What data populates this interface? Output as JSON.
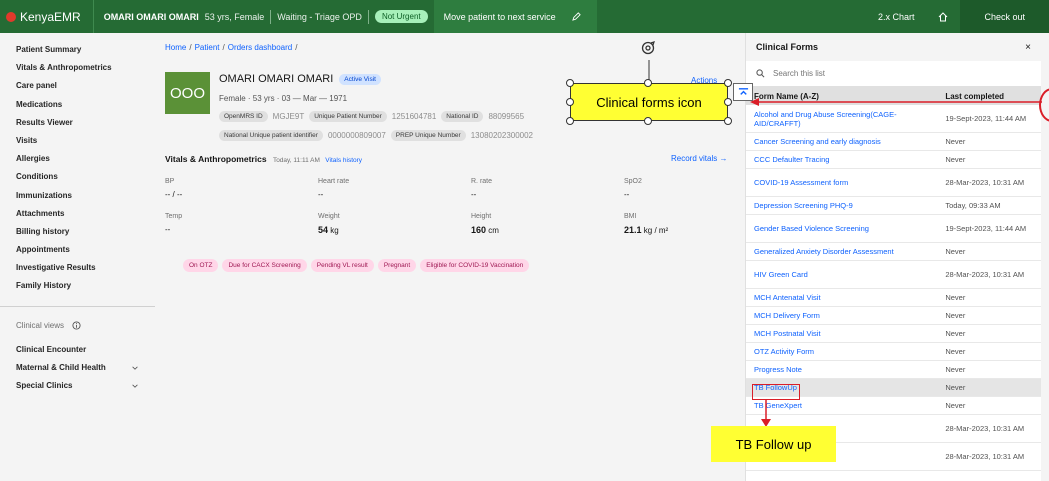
{
  "topbar": {
    "brand": "KenyaEMR",
    "patient_name": "OMARI OMARI OMARI",
    "patient_meta": "53 yrs, Female",
    "queue_status": "Waiting - Triage OPD",
    "priority": "Not Urgent",
    "move_label": "Move patient to next service",
    "chart_label": "2.x Chart",
    "checkout_label": "Check out"
  },
  "sidebar": {
    "items": [
      "Patient Summary",
      "Vitals & Anthropometrics",
      "Care panel",
      "Medications",
      "Results Viewer",
      "Visits",
      "Allergies",
      "Conditions",
      "Immunizations",
      "Attachments",
      "Billing history",
      "Appointments",
      "Investigative Results",
      "Family History"
    ],
    "clinical_views_label": "Clinical views",
    "clinical_items": [
      "Clinical Encounter",
      "Maternal & Child Health",
      "Special Clinics"
    ]
  },
  "breadcrumb": {
    "home": "Home",
    "patient": "Patient",
    "orders": "Orders dashboard"
  },
  "patient": {
    "initials": "OOO",
    "name": "OMARI OMARI OMARI",
    "visit_badge": "Active Visit",
    "demographics": "Female · 53 yrs · 03 — Mar — 1971",
    "openmrs_label": "OpenMRS ID",
    "openmrs_value": "MGJE9T",
    "upn_label": "Unique Patient Number",
    "upn_value": "1251604781",
    "national_label": "National ID",
    "national_value": "88099565",
    "nupi_label": "National Unique patient identifier",
    "nupi_value": "0000000809007",
    "prep_label": "PREP Unique Number",
    "prep_value": "13080202300002",
    "actions_label": "Actions"
  },
  "vitals": {
    "title": "Vitals & Anthropometrics",
    "when": "Today, 11:11 AM",
    "history_link": "Vitals history",
    "record_label": "Record vitals →",
    "bp_label": "BP",
    "bp_value": "-- / --",
    "hr_label": "Heart rate",
    "hr_value": "--",
    "rr_label": "R. rate",
    "rr_value": "--",
    "spo2_label": "SpO2",
    "spo2_value": "--",
    "temp_label": "Temp",
    "temp_value": "--",
    "weight_label": "Weight",
    "weight_value": "54",
    "weight_unit": "kg",
    "height_label": "Height",
    "height_value": "160",
    "height_unit": "cm",
    "bmi_label": "BMI",
    "bmi_value": "21.1",
    "bmi_unit": "kg / m²"
  },
  "flags": [
    "On OTZ",
    "Due for CACX Screening",
    "Pending VL result",
    "Pregnant",
    "Eligible for COVID-19 Vaccination"
  ],
  "annotations": {
    "callout_1": "Clinical forms icon",
    "callout_2": "TB Follow up"
  },
  "panel": {
    "title": "Clinical Forms",
    "close": "×",
    "search_placeholder": "Search this list",
    "col_name": "Form Name (A-Z)",
    "col_last": "Last completed",
    "rows": [
      {
        "name": "Alcohol and Drug Abuse Screening(CAGE-AID/CRAFFT)",
        "last": "19-Sept-2023, 11:44 AM"
      },
      {
        "name": "Cancer Screening and early diagnosis",
        "last": "Never"
      },
      {
        "name": "CCC Defaulter Tracing",
        "last": "Never"
      },
      {
        "name": "COVID-19 Assessment form",
        "last": "28-Mar-2023, 10:31 AM"
      },
      {
        "name": "Depression Screening PHQ-9",
        "last": "Today, 09:33 AM"
      },
      {
        "name": "Gender Based Violence Screening",
        "last": "19-Sept-2023, 11:44 AM"
      },
      {
        "name": "Generalized Anxiety Disorder Assessment",
        "last": "Never"
      },
      {
        "name": "HIV Green Card",
        "last": "28-Mar-2023, 10:31 AM"
      },
      {
        "name": "MCH Antenatal Visit",
        "last": "Never"
      },
      {
        "name": "MCH Delivery Form",
        "last": "Never"
      },
      {
        "name": "MCH Postnatal Visit",
        "last": "Never"
      },
      {
        "name": "OTZ Activity Form",
        "last": "Never"
      },
      {
        "name": "Progress Note",
        "last": "Never"
      },
      {
        "name": "TB FollowUp",
        "last": "Never"
      },
      {
        "name": "TB GeneXpert",
        "last": "Never"
      },
      {
        "name": "",
        "last": "28-Mar-2023, 10:31 AM"
      },
      {
        "name": "",
        "last": "28-Mar-2023, 10:31 AM"
      }
    ]
  },
  "colors": {
    "topbar": "#256b34",
    "link": "#0f62fe",
    "annotation": "#ffff33",
    "highlight": "#da1e28"
  },
  "icons": [
    "home-icon",
    "edit-icon",
    "close-icon",
    "search-icon",
    "info-icon",
    "chevron-down-icon",
    "collapse-panel-icon",
    "cursor-rotate-icon"
  ]
}
